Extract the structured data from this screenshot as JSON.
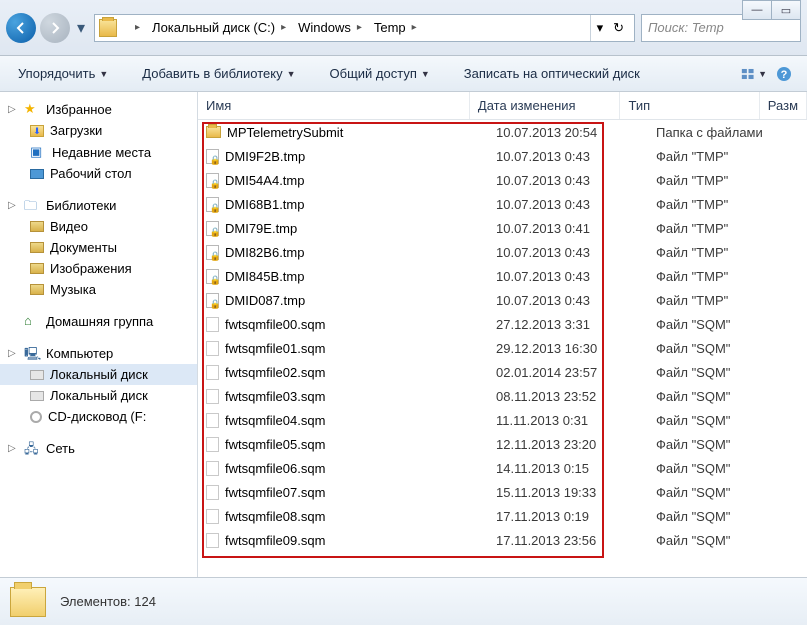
{
  "window": {
    "min": "—",
    "max": "▭",
    "close": "✕"
  },
  "nav": {
    "back_aria": "Back",
    "fwd_aria": "Forward",
    "crumbs": [
      "Локальный диск (C:)",
      "Windows",
      "Temp"
    ],
    "dropdown_glyph": "▾",
    "refresh_glyph": "↻",
    "search_placeholder": "Поиск: Temp"
  },
  "toolbar": {
    "organize": "Упорядочить",
    "add_library": "Добавить в библиотеку",
    "share": "Общий доступ",
    "burn": "Записать на оптический диск"
  },
  "sidebar": {
    "favorites": {
      "label": "Избранное",
      "items": [
        {
          "label": "Загрузки",
          "icon": "downloads"
        },
        {
          "label": "Недавние места",
          "icon": "recent"
        },
        {
          "label": "Рабочий стол",
          "icon": "desktop"
        }
      ]
    },
    "libraries": {
      "label": "Библиотеки",
      "items": [
        {
          "label": "Видео",
          "icon": "folder"
        },
        {
          "label": "Документы",
          "icon": "folder"
        },
        {
          "label": "Изображения",
          "icon": "folder"
        },
        {
          "label": "Музыка",
          "icon": "folder"
        }
      ]
    },
    "homegroup": {
      "label": "Домашняя группа"
    },
    "computer": {
      "label": "Компьютер",
      "items": [
        {
          "label": "Локальный диск",
          "icon": "disk",
          "selected": true
        },
        {
          "label": "Локальный диск",
          "icon": "disk"
        },
        {
          "label": "CD-дисковод (F:",
          "icon": "cd"
        }
      ]
    },
    "network": {
      "label": "Сеть"
    }
  },
  "columns": {
    "name": "Имя",
    "date": "Дата изменения",
    "type": "Тип",
    "size": "Разм"
  },
  "files": [
    {
      "name": "MPTelemetrySubmit",
      "date": "10.07.2013 20:54",
      "type": "Папка с файлами",
      "icon": "folder"
    },
    {
      "name": "DMI9F2B.tmp",
      "date": "10.07.2013 0:43",
      "type": "Файл \"TMP\"",
      "icon": "tmp"
    },
    {
      "name": "DMI54A4.tmp",
      "date": "10.07.2013 0:43",
      "type": "Файл \"TMP\"",
      "icon": "tmp"
    },
    {
      "name": "DMI68B1.tmp",
      "date": "10.07.2013 0:43",
      "type": "Файл \"TMP\"",
      "icon": "tmp"
    },
    {
      "name": "DMI79E.tmp",
      "date": "10.07.2013 0:41",
      "type": "Файл \"TMP\"",
      "icon": "tmp"
    },
    {
      "name": "DMI82B6.tmp",
      "date": "10.07.2013 0:43",
      "type": "Файл \"TMP\"",
      "icon": "tmp"
    },
    {
      "name": "DMI845B.tmp",
      "date": "10.07.2013 0:43",
      "type": "Файл \"TMP\"",
      "icon": "tmp"
    },
    {
      "name": "DMID087.tmp",
      "date": "10.07.2013 0:43",
      "type": "Файл \"TMP\"",
      "icon": "tmp"
    },
    {
      "name": "fwtsqmfile00.sqm",
      "date": "27.12.2013 3:31",
      "type": "Файл \"SQM\"",
      "icon": "sqm"
    },
    {
      "name": "fwtsqmfile01.sqm",
      "date": "29.12.2013 16:30",
      "type": "Файл \"SQM\"",
      "icon": "sqm"
    },
    {
      "name": "fwtsqmfile02.sqm",
      "date": "02.01.2014 23:57",
      "type": "Файл \"SQM\"",
      "icon": "sqm"
    },
    {
      "name": "fwtsqmfile03.sqm",
      "date": "08.11.2013 23:52",
      "type": "Файл \"SQM\"",
      "icon": "sqm"
    },
    {
      "name": "fwtsqmfile04.sqm",
      "date": "11.11.2013 0:31",
      "type": "Файл \"SQM\"",
      "icon": "sqm"
    },
    {
      "name": "fwtsqmfile05.sqm",
      "date": "12.11.2013 23:20",
      "type": "Файл \"SQM\"",
      "icon": "sqm"
    },
    {
      "name": "fwtsqmfile06.sqm",
      "date": "14.11.2013 0:15",
      "type": "Файл \"SQM\"",
      "icon": "sqm"
    },
    {
      "name": "fwtsqmfile07.sqm",
      "date": "15.11.2013 19:33",
      "type": "Файл \"SQM\"",
      "icon": "sqm"
    },
    {
      "name": "fwtsqmfile08.sqm",
      "date": "17.11.2013 0:19",
      "type": "Файл \"SQM\"",
      "icon": "sqm"
    },
    {
      "name": "fwtsqmfile09.sqm",
      "date": "17.11.2013 23:56",
      "type": "Файл \"SQM\"",
      "icon": "sqm"
    }
  ],
  "status": {
    "label": "Элементов:",
    "count": "124"
  }
}
